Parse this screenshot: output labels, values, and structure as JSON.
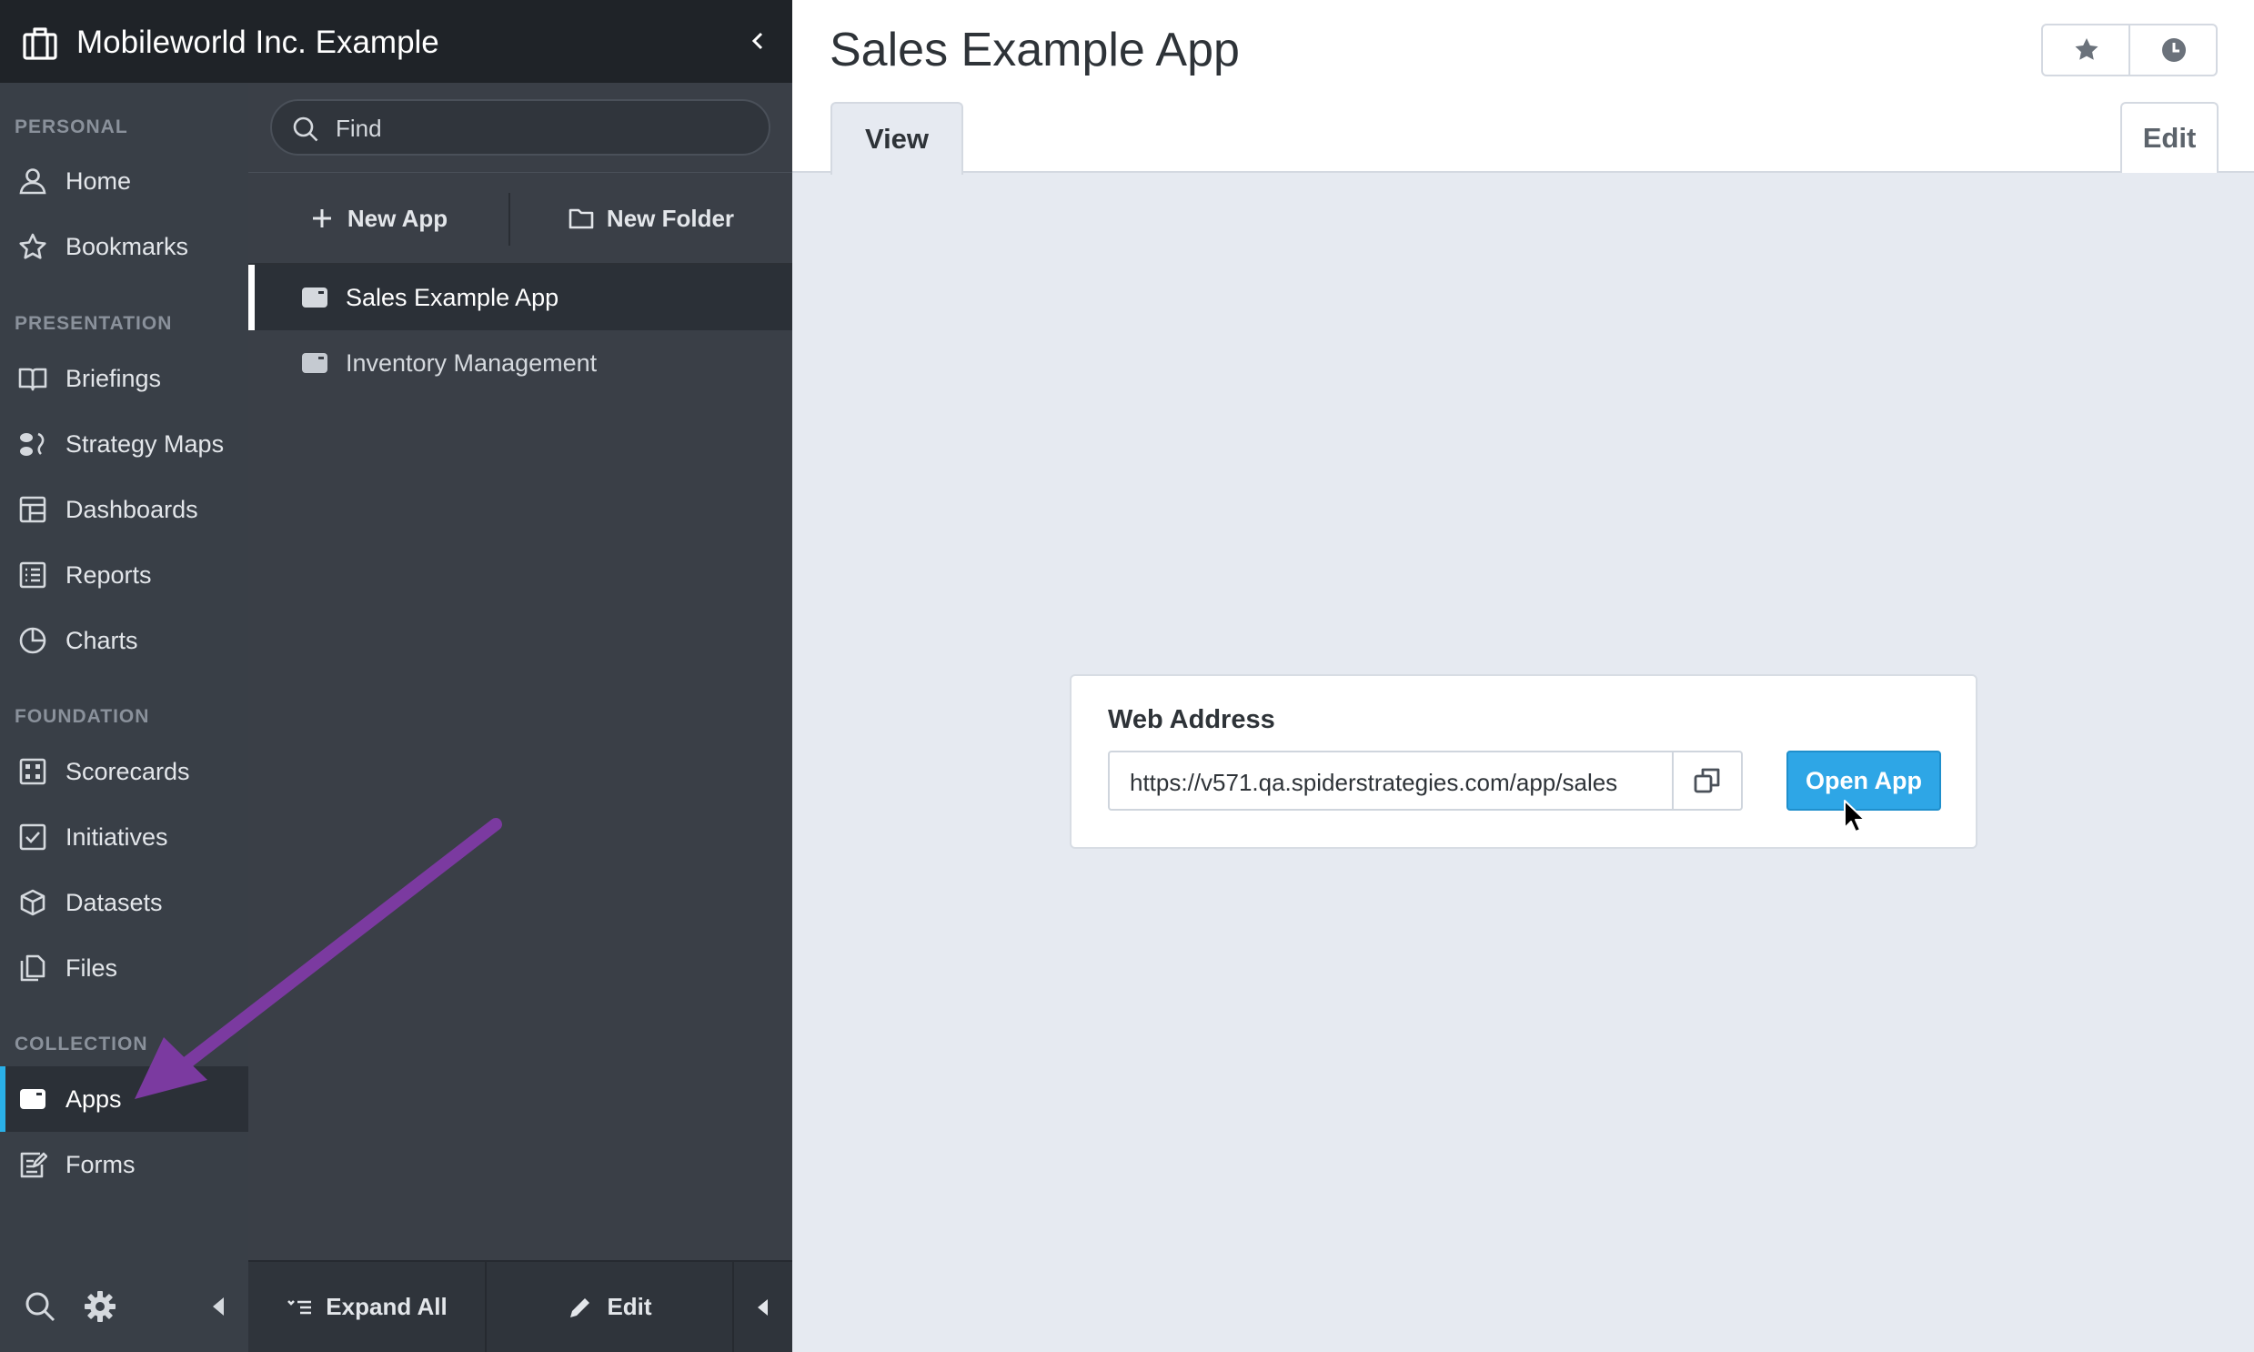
{
  "org": {
    "name": "Mobileworld Inc. Example"
  },
  "sidebar": {
    "sections": [
      {
        "label": "PERSONAL"
      },
      {
        "label": "PRESENTATION"
      },
      {
        "label": "FOUNDATION"
      },
      {
        "label": "COLLECTION"
      }
    ],
    "items": [
      {
        "label": "Home",
        "icon": "person-icon"
      },
      {
        "label": "Bookmarks",
        "icon": "star-outline-icon"
      },
      {
        "label": "Briefings",
        "icon": "open-book-icon"
      },
      {
        "label": "Strategy Maps",
        "icon": "strategy-map-icon"
      },
      {
        "label": "Dashboards",
        "icon": "dashboard-icon"
      },
      {
        "label": "Reports",
        "icon": "report-list-icon"
      },
      {
        "label": "Charts",
        "icon": "pie-chart-icon"
      },
      {
        "label": "Scorecards",
        "icon": "scorecard-icon"
      },
      {
        "label": "Initiatives",
        "icon": "checkbox-icon"
      },
      {
        "label": "Datasets",
        "icon": "cube-icon"
      },
      {
        "label": "Files",
        "icon": "files-icon"
      },
      {
        "label": "Apps",
        "icon": "app-window-icon",
        "active": true
      },
      {
        "label": "Forms",
        "icon": "form-edit-icon"
      }
    ]
  },
  "middle": {
    "search_placeholder": "Find",
    "new_app_label": "New App",
    "new_folder_label": "New Folder",
    "tree": [
      {
        "label": "Sales Example App",
        "selected": true
      },
      {
        "label": "Inventory Management"
      }
    ],
    "expand_all_label": "Expand All",
    "edit_label": "Edit"
  },
  "main": {
    "title": "Sales Example App",
    "tabs": {
      "view": "View",
      "edit": "Edit"
    },
    "card": {
      "label": "Web Address",
      "url": "https://v571.qa.spiderstrategies.com/app/sales",
      "open_label": "Open App"
    }
  },
  "colors": {
    "accent": "#2ab0e8",
    "open_button": "#2ea6e6",
    "annotation_arrow": "#7b3aa0"
  }
}
